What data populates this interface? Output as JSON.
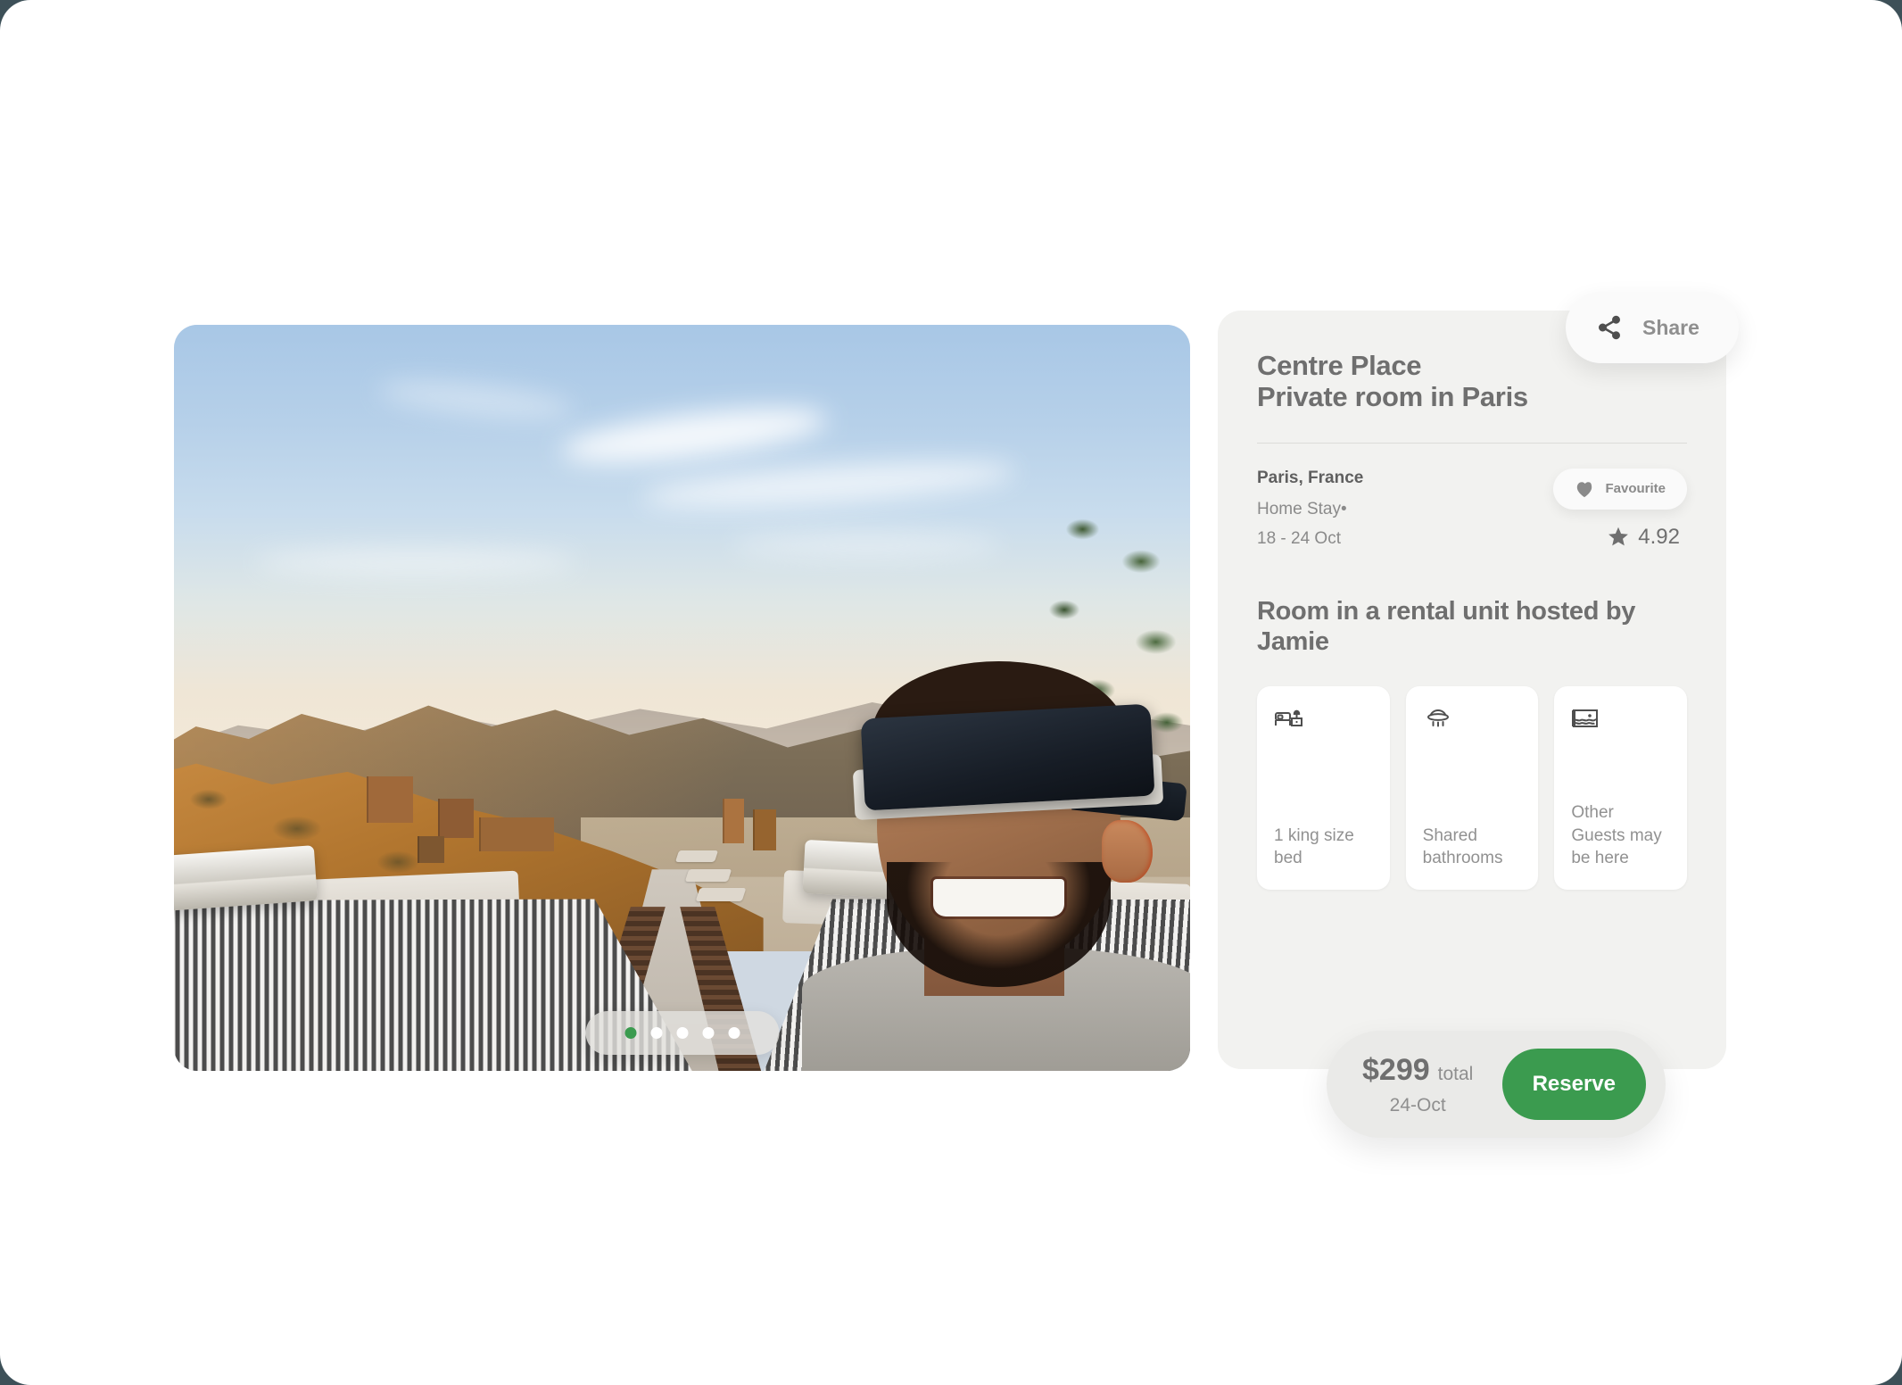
{
  "accent_color": "#3b9b4f",
  "listing": {
    "title_line1": "Centre Place",
    "title_line2": "Private room in Paris",
    "city": "Paris, France",
    "stay_type": "Home Stay•",
    "dates": "18 - 24 Oct",
    "rating": "4.92",
    "host_heading": "Room in a rental unit hosted by Jamie"
  },
  "share": {
    "label": "Share",
    "icon": "share-icon"
  },
  "favourite": {
    "label": "Favourite",
    "icon": "heart-icon"
  },
  "rating_icon": "star-icon",
  "amenities": [
    {
      "icon": "bed-icon",
      "label": "1 king size bed"
    },
    {
      "icon": "shower-icon",
      "label": "Shared bathrooms"
    },
    {
      "icon": "window-icon",
      "label": "Other Guests may be here"
    }
  ],
  "booking": {
    "amount": "$299",
    "unit": "total",
    "date": "24-Oct",
    "reserve_label": "Reserve"
  },
  "carousel": {
    "total_dots": 5,
    "active_index": 0
  }
}
